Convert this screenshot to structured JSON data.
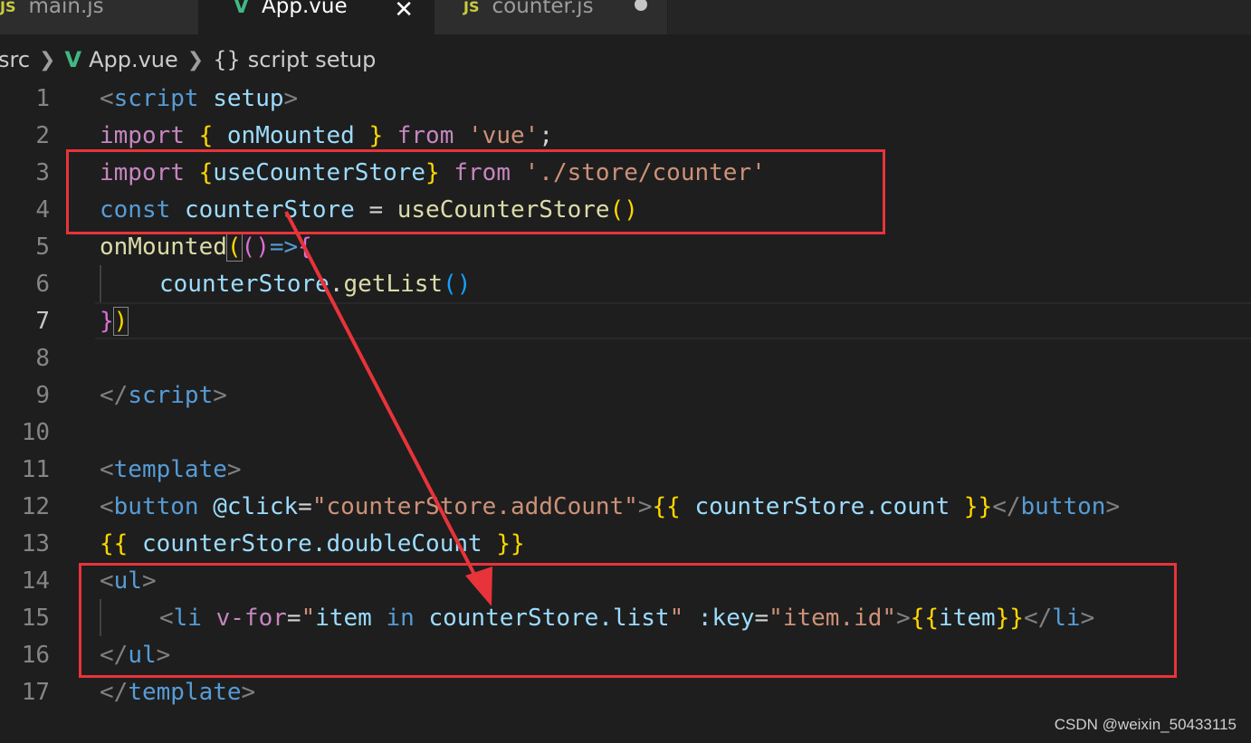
{
  "tabs": [
    {
      "label": "main.js",
      "icon": "JS",
      "active": false
    },
    {
      "label": "App.vue",
      "icon": "V",
      "active": true,
      "close": "✕"
    },
    {
      "label": "counter.js",
      "icon": "JS",
      "active": false,
      "modified": true
    }
  ],
  "breadcrumb": {
    "folder": "src",
    "file": "App.vue",
    "symbol_icon": "{}",
    "symbol": "script setup"
  },
  "line_numbers": [
    "1",
    "2",
    "3",
    "4",
    "5",
    "6",
    "7",
    "8",
    "9",
    "10",
    "11",
    "12",
    "13",
    "14",
    "15",
    "16",
    "17"
  ],
  "code": {
    "l1": {
      "open": "<",
      "tag": "script",
      "attr": "setup",
      "close": ">"
    },
    "l2": {
      "kw": "import",
      "b_open": "{",
      "name": "onMounted",
      "b_close": "}",
      "from": "from",
      "str": "'vue'",
      "semi": ";"
    },
    "l3": {
      "kw": "import",
      "b_open": "{",
      "name": "useCounterStore",
      "b_close": "}",
      "from": "from",
      "str": "'./store/counter'"
    },
    "l4": {
      "kw": "const",
      "var": "counterStore",
      "eq": "=",
      "fn": "useCounterStore",
      "parens": "()"
    },
    "l5": {
      "fn": "onMounted",
      "p_open": "(",
      "args": "()",
      "arrow": "=>",
      "brace": "{"
    },
    "l6": {
      "obj": "counterStore",
      "dot": ".",
      "method": "getList",
      "parens": "()"
    },
    "l7": {
      "brace": "}",
      "p_close": ")"
    },
    "l9": {
      "open": "</",
      "tag": "script",
      "close": ">"
    },
    "l11": {
      "open": "<",
      "tag": "template",
      "close": ">"
    },
    "l12": {
      "open": "<",
      "tag": "button",
      "event": "@click",
      "eq": "=",
      "value": "\"counterStore.addCount\"",
      "gt": ">",
      "m_open": "{{",
      "expr": "counterStore.count",
      "m_close": "}}",
      "end_open": "</",
      "end_tag": "button",
      "end_close": ">"
    },
    "l13": {
      "m_open": "{{",
      "expr": "counterStore.doubleCount",
      "m_close": "}}"
    },
    "l14": {
      "open": "<",
      "tag": "ul",
      "close": ">"
    },
    "l15": {
      "open": "<",
      "tag": "li",
      "directive": "v-for",
      "eq": "=",
      "q": "\"",
      "item": "item",
      "in": "in",
      "list": "counterStore.list",
      "key_attr": ":key",
      "eq2": "=",
      "key_value": "\"item.id\"",
      "gt": ">",
      "m_open": "{{",
      "expr": "item",
      "m_close": "}}",
      "end_open": "</",
      "end_tag": "li",
      "end_close": ">"
    },
    "l16": {
      "open": "</",
      "tag": "ul",
      "close": ">"
    },
    "l17": {
      "open": "</",
      "tag": "template",
      "close": ">"
    }
  },
  "annotation_color": "#e8333a",
  "watermark": "CSDN @weixin_50433115"
}
